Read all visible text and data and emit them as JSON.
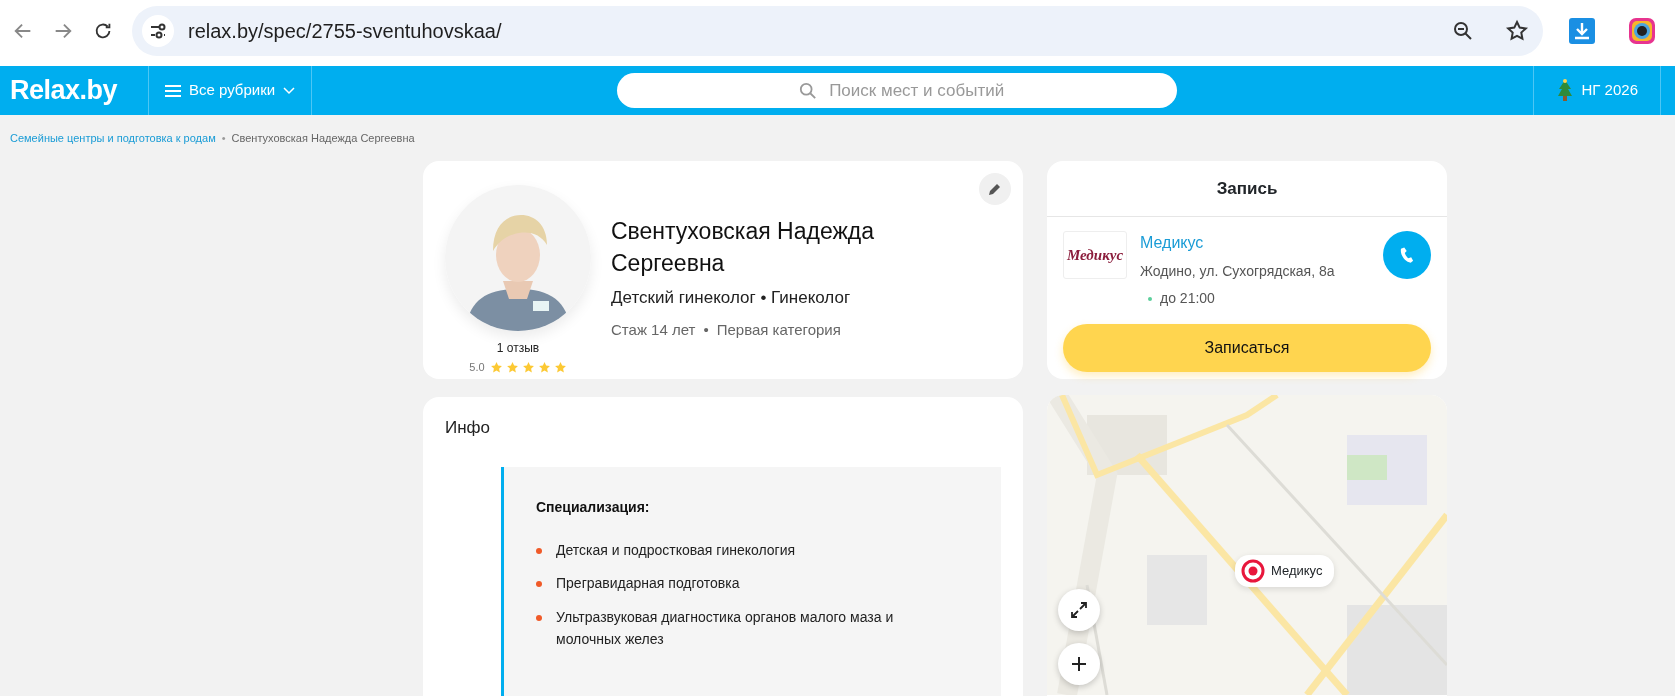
{
  "browser": {
    "url": "relax.by/spec/2755-sventuhovskaa/"
  },
  "header": {
    "logo": "Relax.by",
    "menu": "Все рубрики",
    "search": {
      "placeholder": "Поиск мест и событий"
    },
    "promo": "НГ 2026"
  },
  "breadcrumb_separator": "•",
  "breadcrumbs": [
    {
      "label": "Семейные центры и подготовка к родам",
      "current": false
    },
    {
      "label": "Свентуховская Надежда Сергеевна",
      "current": true
    }
  ],
  "profile": {
    "name": "Свентуховская Надежда Сергеевна",
    "specialties": "Детский гинеколог • Гинеколог",
    "experience": "Стаж 14 лет",
    "separator": "•",
    "category": "Первая категория",
    "reviews": "1 отзыв",
    "rating": "5.0",
    "stars": 5
  },
  "booking": {
    "title": "Запись",
    "clinic": {
      "logo_text": "Медикус",
      "name": "Медикус",
      "address": "Жодино, ул. Сухогрядская, 8а",
      "hours": "до 21:00",
      "open": true
    },
    "button": "Записаться"
  },
  "info": {
    "title": "Инфо",
    "heading": "Специализация:",
    "items": [
      "Детская и подростковая гинекология",
      "Прегравидарная подготовка",
      "Ультразвуковая диагностика органов малого маза и молочных желез"
    ]
  },
  "map": {
    "marker": "Медикус"
  }
}
